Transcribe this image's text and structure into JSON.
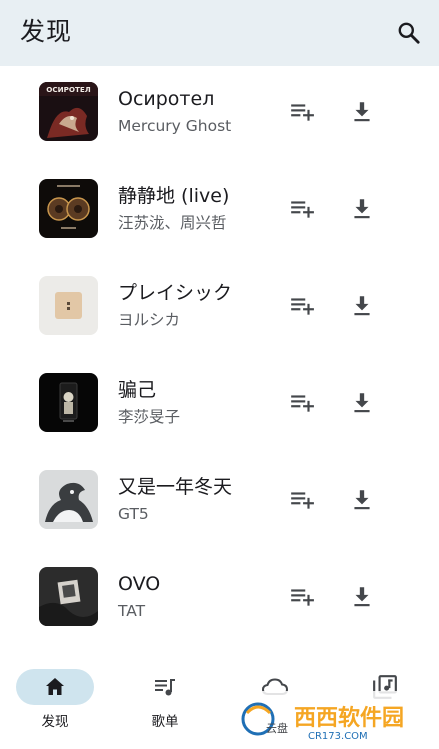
{
  "app_bar": {
    "title": "发现",
    "search_icon": "search-icon"
  },
  "songs": [
    {
      "title": "Осиротел",
      "artist": "Mercury Ghost",
      "cover_text": "ОСИРОТЕЛ"
    },
    {
      "title": "静静地 (live)",
      "artist": "汪苏泷、周兴哲"
    },
    {
      "title": "プレイシック",
      "artist": "ヨルシカ"
    },
    {
      "title": "骗己",
      "artist": "李莎旻子"
    },
    {
      "title": "又是一年冬天",
      "artist": "GT5"
    },
    {
      "title": "OVO",
      "artist": "TAT"
    }
  ],
  "row_actions": {
    "add_icon": "playlist-add-icon",
    "download_icon": "download-icon"
  },
  "nav": {
    "items": [
      {
        "label": "发现",
        "icon": "home-icon",
        "selected": true
      },
      {
        "label": "歌单",
        "icon": "queue-music-icon",
        "selected": false
      },
      {
        "label": "",
        "icon": "cloud-icon",
        "selected": false
      },
      {
        "label": "",
        "icon": "library-music-icon",
        "selected": false
      }
    ]
  },
  "watermark": {
    "text": "西西软件园",
    "subtext": "CR173.COM",
    "corner_text": "云盘"
  },
  "colors": {
    "app_bar_bg": "#e8eff3",
    "nav_selected_pill": "#cfe4ee",
    "icon": "#44474b",
    "title_text": "#1b1b1f",
    "secondary_text": "#5a5d62",
    "watermark_orange": "#f5a623",
    "watermark_blue": "#1f6fb5"
  }
}
